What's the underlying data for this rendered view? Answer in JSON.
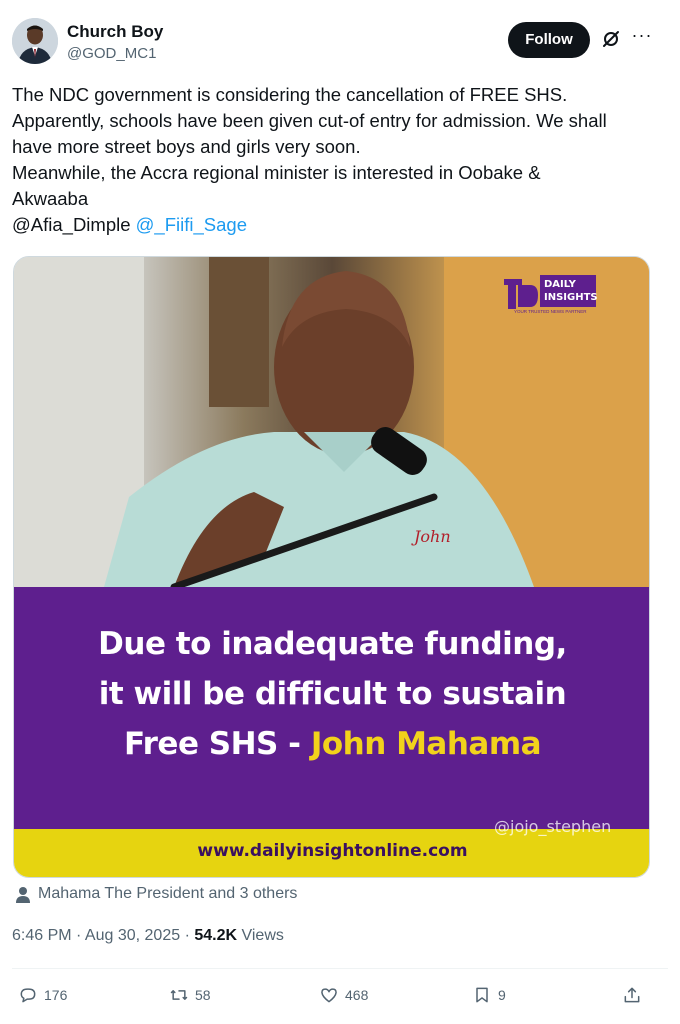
{
  "author": {
    "name": "Church Boy",
    "handle": "@GOD_MC1"
  },
  "header": {
    "follow_label": "Follow"
  },
  "tweet": {
    "lines": [
      "The NDC government is considering the cancellation of FREE SHS.",
      "Apparently, schools have been given cut-of entry for admission. We shall",
      "have more street boys and girls very soon.",
      "Meanwhile, the Accra regional minister is interested in Oobake &",
      "Akwaaba"
    ],
    "mention_plain": "@Afia_Dimple",
    "mention_link": "@_Fiifi_Sage"
  },
  "media": {
    "headline_line1": "Due to inadequate funding,",
    "headline_line2": "it will be difficult to sustain",
    "headline_line3_white": "Free SHS - ",
    "headline_line3_yellow": "John Mahama",
    "watermark": "@jojo_stephen",
    "url": "www.dailyinsightonline.com",
    "logo_text_1": "DAILY",
    "logo_text_2": "INSIGHTS",
    "logo_tagline": "YOUR TRUSTED NEWS PARTNER",
    "shirt_text": "John"
  },
  "tagged": {
    "text": "Mahama The President and 3 others"
  },
  "meta": {
    "time_date": "6:46 PM · Aug 30, 2025 · ",
    "views_count": "54.2K",
    "views_label": " Views"
  },
  "actions": {
    "replies": "176",
    "reposts": "58",
    "likes": "468",
    "bookmarks": "9"
  },
  "colors": {
    "accent_link": "#1d9bf0",
    "purple": "#5e1f8e",
    "yellow": "#f2d21b"
  }
}
